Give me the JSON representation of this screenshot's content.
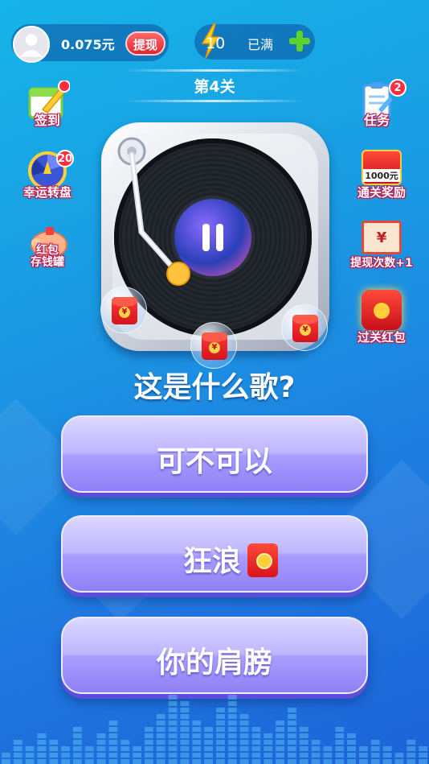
{
  "header": {
    "balance": "0.075元",
    "withdraw_label": "提现",
    "energy_count": "10",
    "energy_status": "已满"
  },
  "level": {
    "title": "第4关"
  },
  "left_menu": [
    {
      "label": "签到",
      "icon": "calendar-checkin-icon"
    },
    {
      "label": "幸运转盘",
      "icon": "lucky-wheel-icon",
      "badge": "20"
    },
    {
      "label": "红包存钱罐",
      "line1": "红包",
      "line2": "存钱罐",
      "icon": "piggy-bank-icon"
    }
  ],
  "right_menu": [
    {
      "label": "任务",
      "icon": "task-clipboard-icon",
      "badge": "2"
    },
    {
      "label": "通关奖励",
      "icon": "clear-reward-icon",
      "amount": "1000元"
    },
    {
      "label": "提现次数+1",
      "icon": "withdraw-ticket-icon"
    },
    {
      "label": "过关红包",
      "icon": "level-redpacket-icon"
    }
  ],
  "question": "这是什么歌?",
  "answers": [
    {
      "text": "可不可以",
      "has_redpacket": false
    },
    {
      "text": "狂浪",
      "has_redpacket": true
    },
    {
      "text": "你的肩膀",
      "has_redpacket": false
    }
  ],
  "colors": {
    "background_top": "#16b4e8",
    "background_bottom": "#1c63d8",
    "answer_button": "#bfb6ff",
    "accent_red": "#e0262e"
  }
}
